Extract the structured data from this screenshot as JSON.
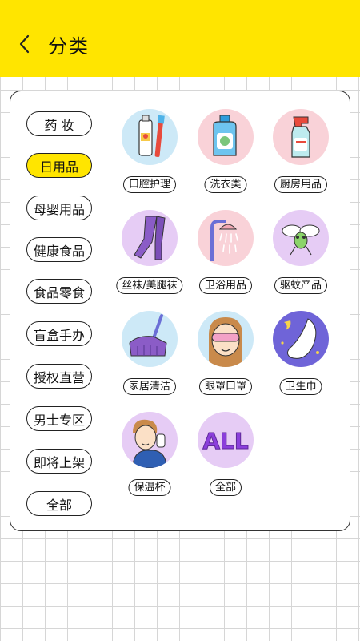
{
  "header": {
    "title": "分类",
    "bg": "#FFE500"
  },
  "categories": [
    {
      "label": "药 妆",
      "active": false
    },
    {
      "label": "日用品",
      "active": true
    },
    {
      "label": "母婴用品",
      "active": false
    },
    {
      "label": "健康食品",
      "active": false
    },
    {
      "label": "食品零食",
      "active": false
    },
    {
      "label": "盲盒手办",
      "active": false
    },
    {
      "label": "授权直营",
      "active": false
    },
    {
      "label": "男士专区",
      "active": false
    },
    {
      "label": "即将上架",
      "active": false
    },
    {
      "label": "全部",
      "active": false
    }
  ],
  "products": [
    {
      "label": "口腔护理",
      "icon": "toothpaste-icon",
      "bg": "#CDE9F7"
    },
    {
      "label": "洗衣类",
      "icon": "detergent-icon",
      "bg": "#F9D2D8"
    },
    {
      "label": "厨房用品",
      "icon": "spray-bottle-icon",
      "bg": "#F9D2D8"
    },
    {
      "label": "丝袜/美腿袜",
      "icon": "stockings-icon",
      "bg": "#E6CCF5"
    },
    {
      "label": "卫浴用品",
      "icon": "shower-icon",
      "bg": "#F9D2D8"
    },
    {
      "label": "驱蚊产品",
      "icon": "mosquito-icon",
      "bg": "#E6CCF5"
    },
    {
      "label": "家居清洁",
      "icon": "broom-icon",
      "bg": "#CDE9F7"
    },
    {
      "label": "眼罩口罩",
      "icon": "mask-girl-icon",
      "bg": "#CDE9F7"
    },
    {
      "label": "卫生巾",
      "icon": "sanitary-pad-icon",
      "bg": "#6F64D8"
    },
    {
      "label": "保温杯",
      "icon": "man-with-cup-icon",
      "bg": "#E6CCF5"
    },
    {
      "label": "全部",
      "icon": "all-icon",
      "bg": "#E6CCF5"
    }
  ],
  "all_art_text": "ALL"
}
